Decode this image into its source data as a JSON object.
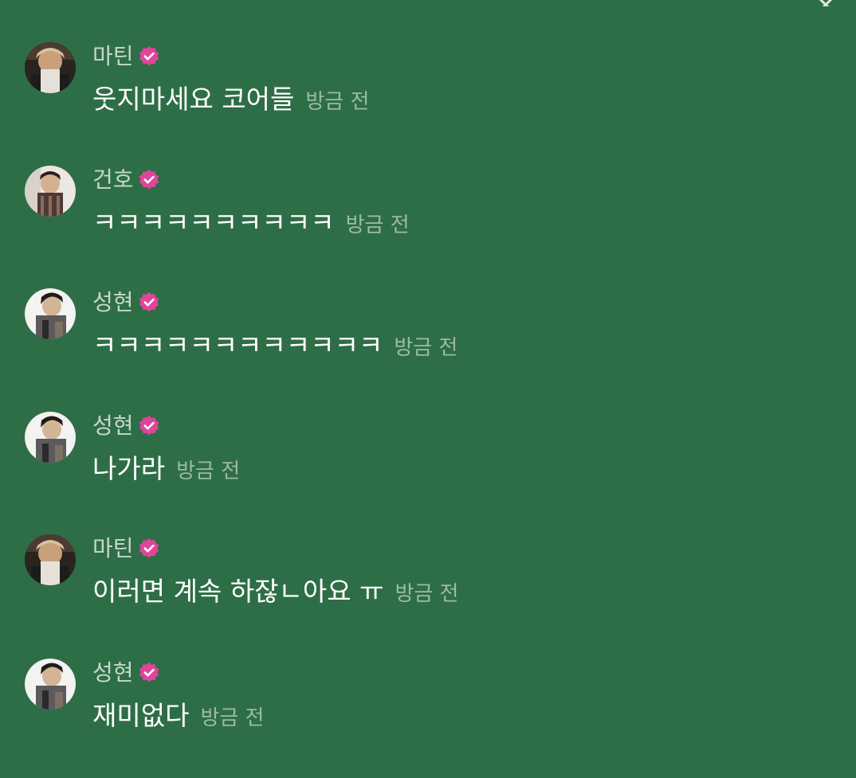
{
  "messages": [
    {
      "name": "마틴",
      "text": "웃지마세요 코어들",
      "time": "방금 전",
      "avatar": "martin"
    },
    {
      "name": "건호",
      "text": "ㅋㅋㅋㅋㅋㅋㅋㅋㅋㅋ",
      "time": "방금 전",
      "avatar": "geonho"
    },
    {
      "name": "성현",
      "text": "ㅋㅋㅋㅋㅋㅋㅋㅋㅋㅋㅋㅋ",
      "time": "방금 전",
      "avatar": "seonghyeon"
    },
    {
      "name": "성현",
      "text": "나가라",
      "time": "방금 전",
      "avatar": "seonghyeon"
    },
    {
      "name": "마틴",
      "text": "이러면 계속 하잖ㄴ아요 ㅠ",
      "time": "방금 전",
      "avatar": "martin"
    },
    {
      "name": "성현",
      "text": "재미없다",
      "time": "방금 전",
      "avatar": "seonghyeon"
    }
  ],
  "colors": {
    "background": "#2e6e46",
    "badge": "#e0459a",
    "name": "#c6d8cd",
    "time": "#9cbaa7",
    "text": "#ffffff"
  },
  "icons": {
    "badge": "verified-badge-icon",
    "close": "close-icon"
  }
}
